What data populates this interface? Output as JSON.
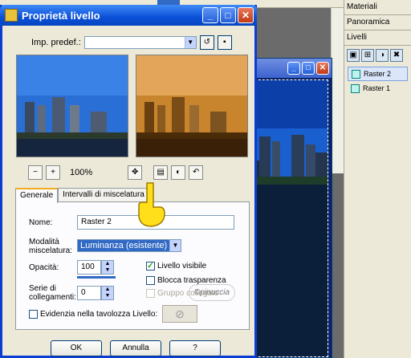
{
  "dialog": {
    "title": "Proprietà livello",
    "preset_label": "Imp. predef.:",
    "preset_value": "",
    "zoom": "100%",
    "tabs": [
      "Generale",
      "Intervalli di miscelatura"
    ],
    "name_label": "Nome:",
    "name_value": "Raster 2",
    "blend_label": "Modalità miscelatura:",
    "blend_value": "Luminanza (esistente)",
    "opacity_label": "Opacità:",
    "opacity_value": "100",
    "opacity_fraction": 1.0,
    "group_label": "Serie di collegamenti:",
    "group_value": "0",
    "visible_label": "Livello visibile",
    "visible_checked": true,
    "lock_label": "Blocca trasparenza",
    "lock_checked": false,
    "grouped_label": "Gruppo collegato",
    "highlight_label": "Evidenzia nella tavolozza Livello:",
    "ok_label": "OK",
    "cancel_label": "Annulla",
    "help_label": "?"
  },
  "panel": {
    "tabs": [
      "Materiali",
      "Panoramica",
      "Livelli"
    ],
    "layers": [
      "Raster 2",
      "Raster 1"
    ]
  },
  "watermark": "©pinuccia",
  "colors": {
    "title_blue": "#0a50d8",
    "sepia": "#c9852d",
    "sky": "#2a6fd6"
  }
}
